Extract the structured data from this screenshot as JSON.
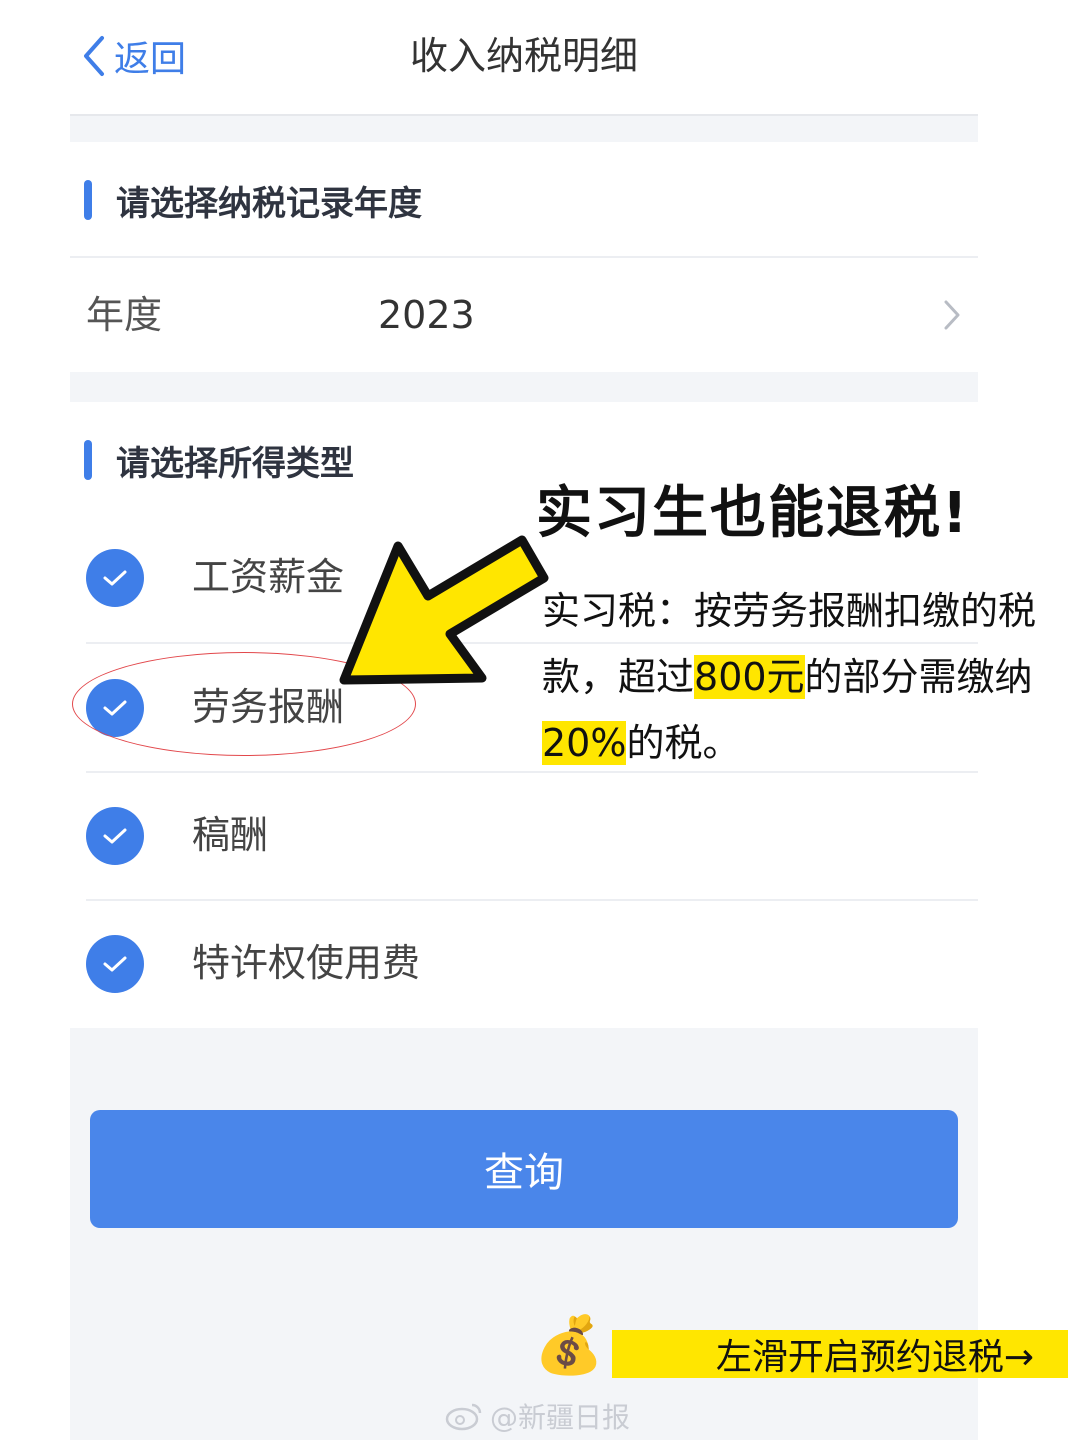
{
  "nav": {
    "back_label": "返回",
    "title": "收入纳税明细"
  },
  "year_section": {
    "heading": "请选择纳税记录年度",
    "label": "年度",
    "value": "2023"
  },
  "type_section": {
    "heading": "请选择所得类型",
    "options": [
      {
        "label": "工资薪金",
        "checked": true
      },
      {
        "label": "劳务报酬",
        "checked": true
      },
      {
        "label": "稿酬",
        "checked": true
      },
      {
        "label": "特许权使用费",
        "checked": true
      }
    ]
  },
  "query_button": {
    "label": "查询"
  },
  "annotation": {
    "headline": "实习生也能退税!",
    "text_1": "实习税：按劳务报酬扣缴的税款，超过",
    "highlight_1": "800元",
    "text_2": "的部分需缴纳",
    "highlight_2": "20%",
    "text_3": "的税。"
  },
  "footer": {
    "swipe_label": "左滑开启预约退税→",
    "watermark": "@新疆日报"
  },
  "colors": {
    "accent": "#3f7ee8",
    "button": "#4a86ea",
    "highlight": "#ffe600",
    "circle": "#e2474b"
  },
  "icons": [
    "chevron-left-icon",
    "chevron-right-icon",
    "check-icon",
    "yellow-arrow-icon",
    "money-bag-icon",
    "weibo-icon"
  ]
}
